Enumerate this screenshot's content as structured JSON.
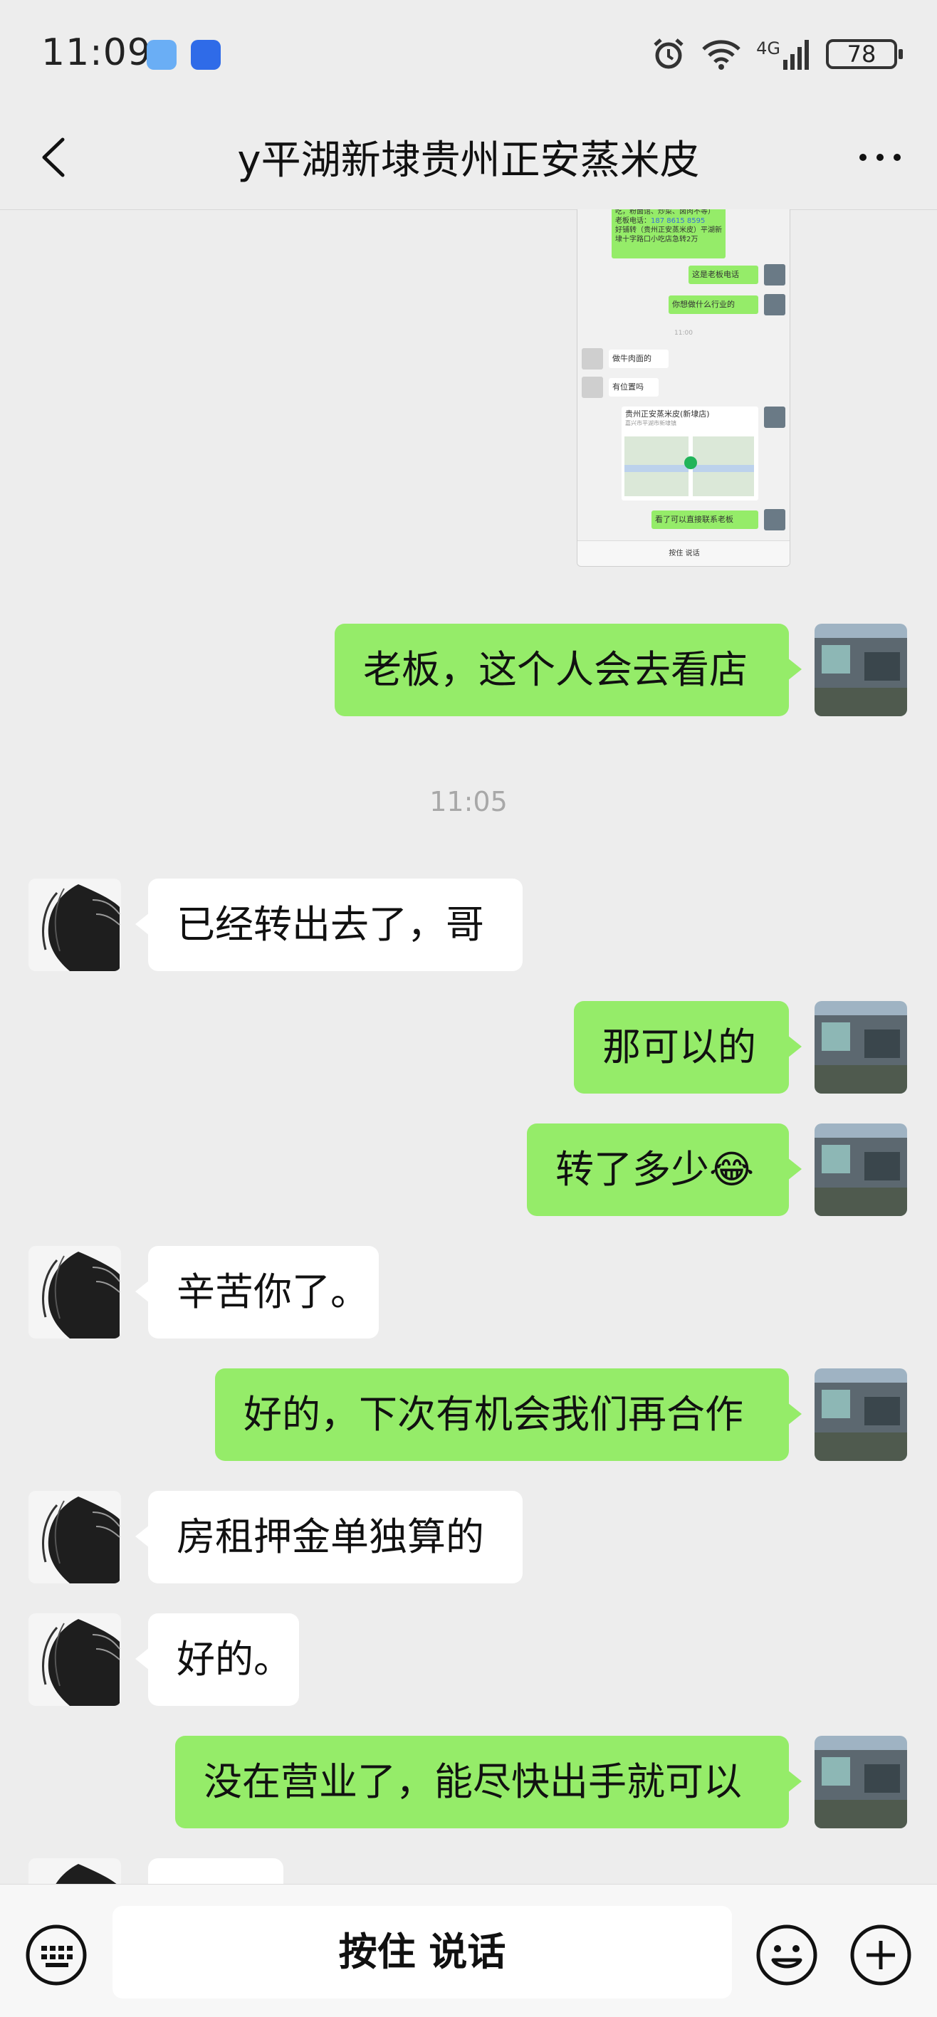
{
  "status_bar": {
    "time": "11:09",
    "network": "4G",
    "battery": "78"
  },
  "header": {
    "title": "y平湖新埭贵州正安蒸米皮"
  },
  "screenshot": {
    "text_info": "手机可以住人，十字路口位置，正常营业中，适合开：各类餐饮小吃，粉面馆、炒菜、卤肉不等）",
    "text_phone_label": "老板电话：",
    "text_phone": "187 8615 8595",
    "text_transfer": "好铺转（贵州正安蒸米皮）平湖新埭十字路口小吃店急转2万",
    "msg1": "这是老板电话",
    "msg2": "你想做什么行业的",
    "ts": "11:00",
    "msg3": "做牛肉面的",
    "msg4": "有位置吗",
    "loc_title": "贵州正安蒸米皮(新埭店)",
    "loc_addr": "嘉兴市平湖市新埭镇",
    "msg5": "看了可以直接联系老板",
    "voice": "按住 说话"
  },
  "messages": [
    {
      "side": "me",
      "text": "老板，这个人会去看店"
    },
    {
      "side": "time",
      "text": "11:05"
    },
    {
      "side": "them",
      "text": "已经转出去了，哥"
    },
    {
      "side": "me",
      "text": "那可以的"
    },
    {
      "side": "me",
      "text": "转了多少",
      "emoji": "😂"
    },
    {
      "side": "them",
      "text": "辛苦你了。"
    },
    {
      "side": "me",
      "text": "好的，下次有机会我们再合作"
    },
    {
      "side": "them",
      "text": "房租押金单独算的"
    },
    {
      "side": "them",
      "text": "好的。"
    },
    {
      "side": "me",
      "text": "没在营业了，能尽快出手就可以"
    }
  ],
  "input_bar": {
    "voice_label": "按住 说话"
  },
  "colors": {
    "my_bubble": "#95ec69",
    "their_bubble": "#ffffff",
    "background": "#ededed"
  }
}
